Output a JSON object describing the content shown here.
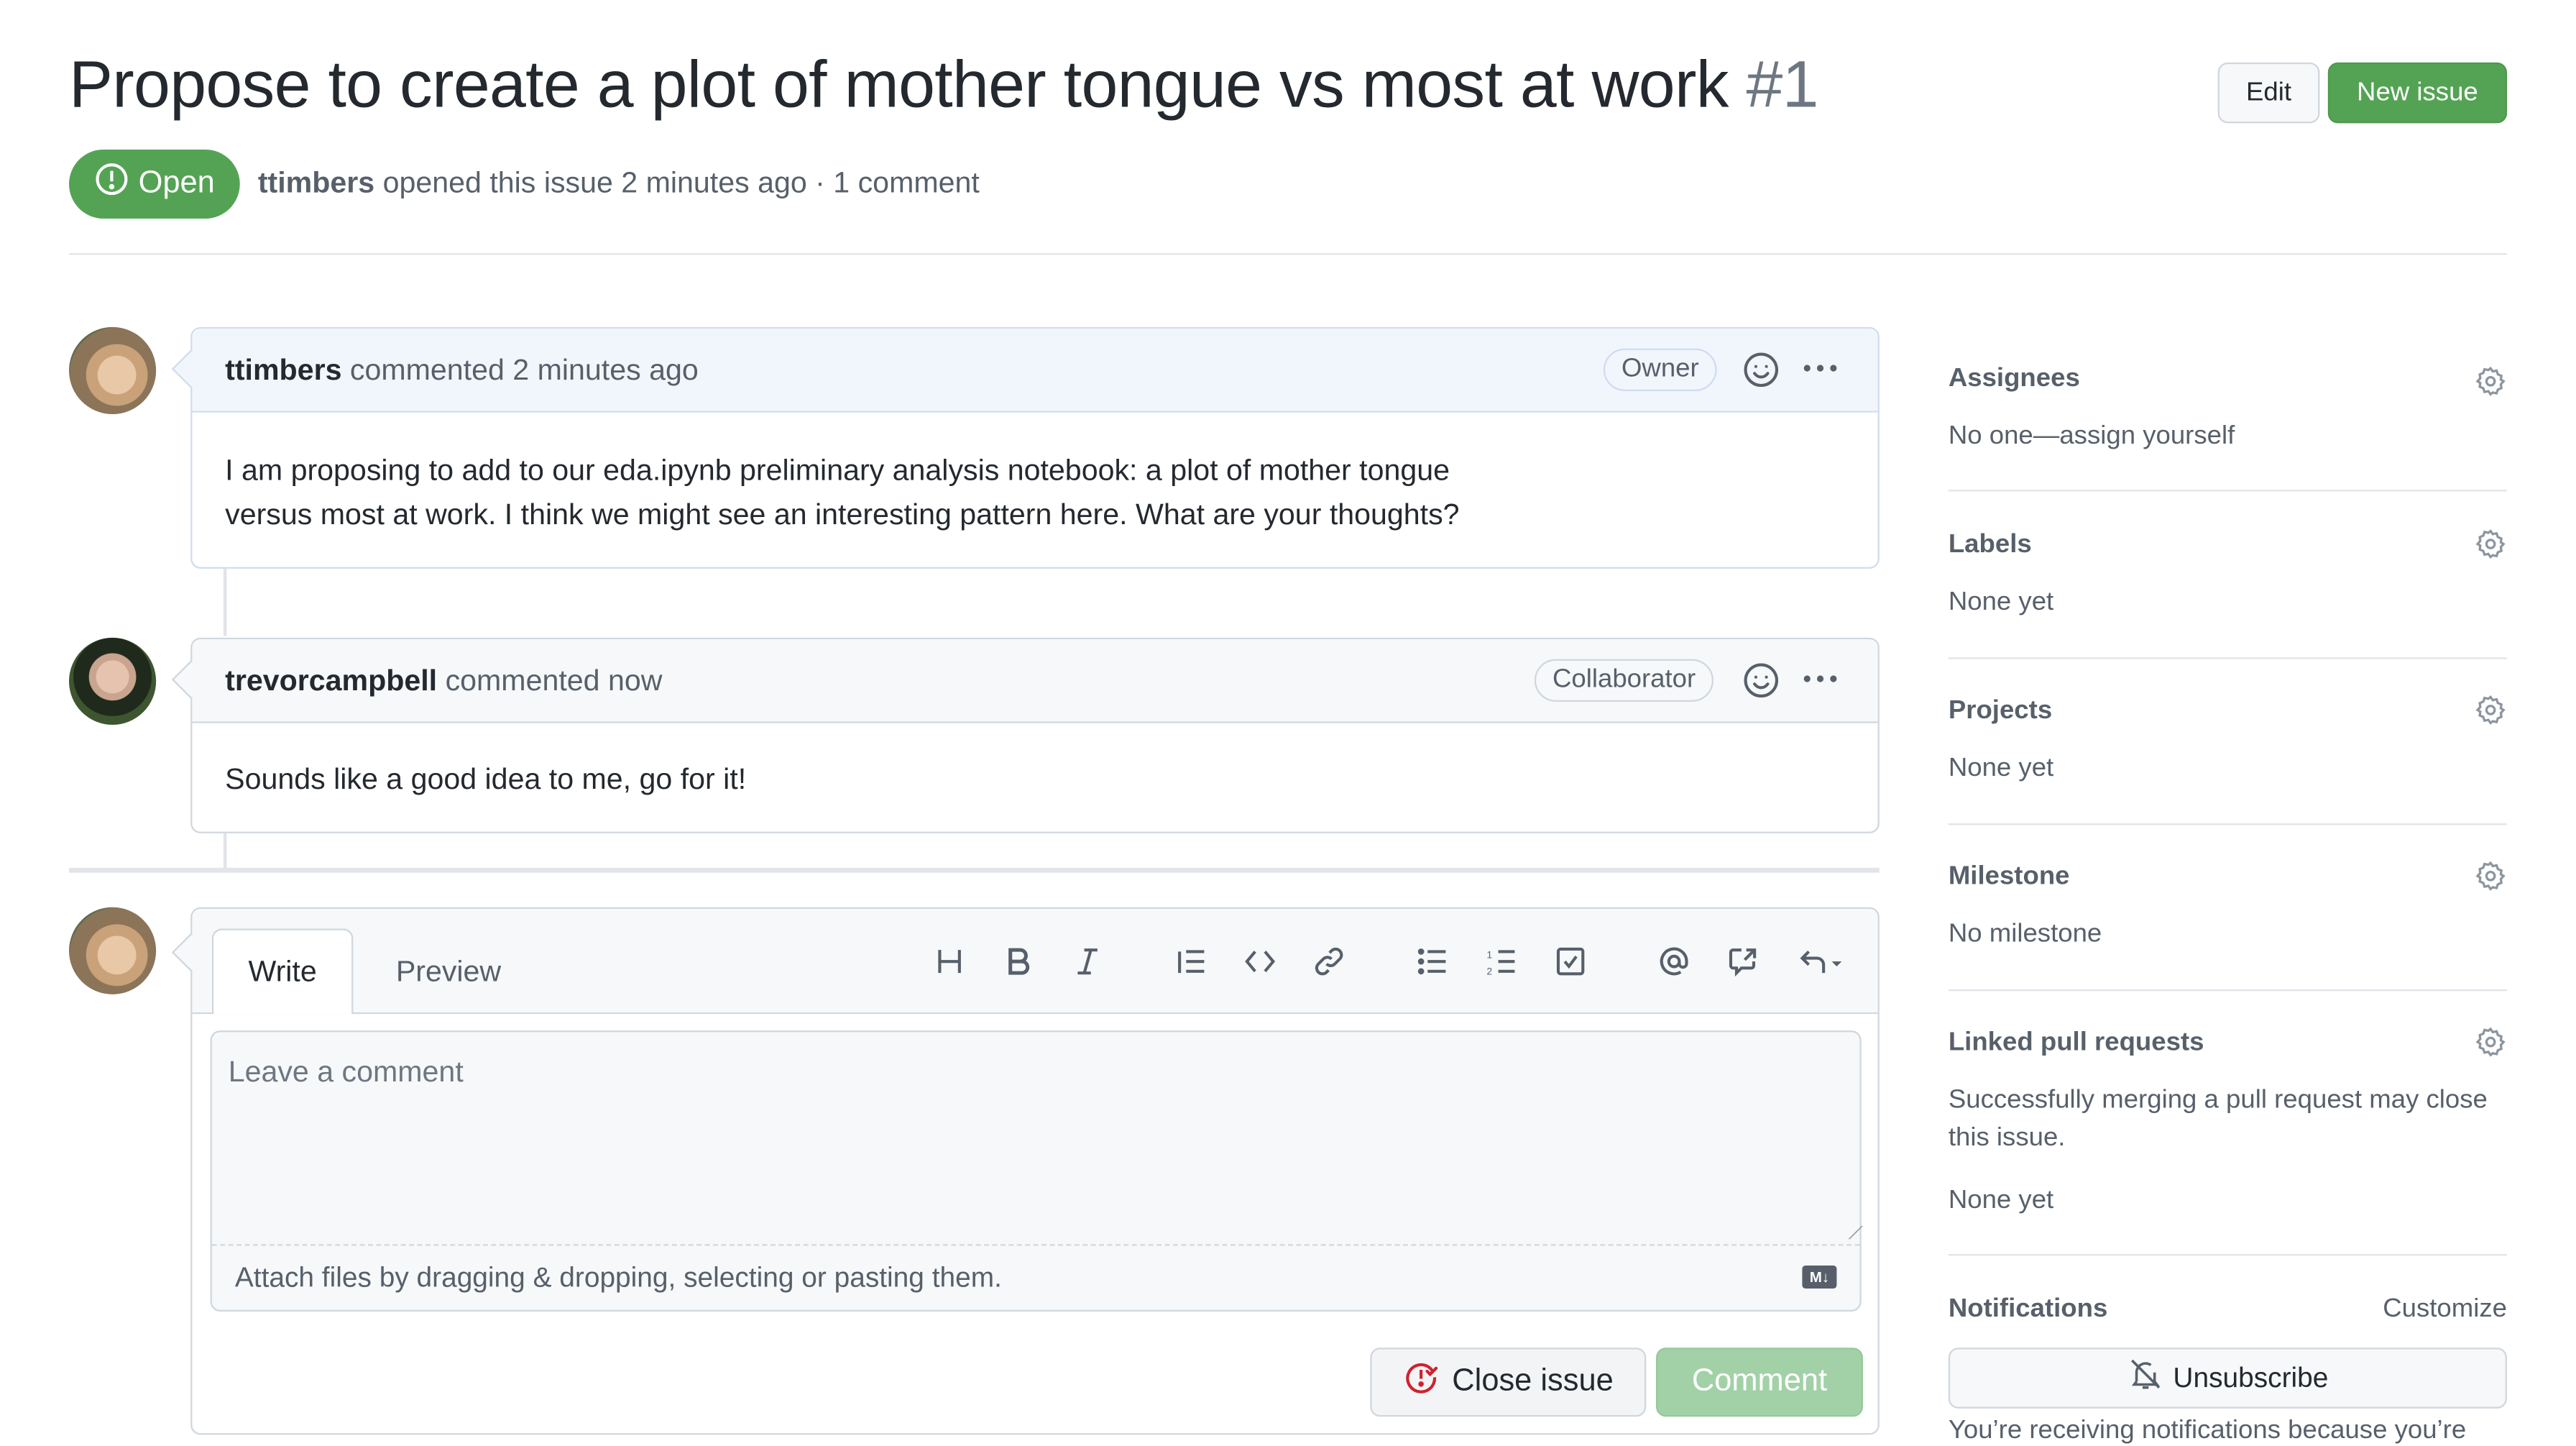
{
  "issue": {
    "title": "Propose to create a plot of mother tongue vs most at work",
    "number": "#1",
    "state": "Open",
    "author": "ttimbers",
    "meta_text": "opened this issue 2 minutes ago · 1 comment"
  },
  "header_actions": {
    "edit_label": "Edit",
    "new_issue_label": "New issue"
  },
  "comments": [
    {
      "author": "ttimbers",
      "action": "commented 2 minutes ago",
      "role": "Owner",
      "body_line1": "I am proposing to add to our eda.ipynb preliminary analysis notebook: a plot of mother tongue",
      "body_line2": "versus most at work. I think we might see an interesting pattern here. What are your thoughts?"
    },
    {
      "author": "trevorcampbell",
      "action": "commented now",
      "role": "Collaborator",
      "body": "Sounds like a good idea to me, go for it!"
    }
  ],
  "editor": {
    "tabs": [
      "Write",
      "Preview"
    ],
    "placeholder": "Leave a comment",
    "value": "",
    "attach_hint": "Attach files by dragging & dropping, selecting or pasting them.",
    "markdown_badge": "M↓",
    "toolbar": [
      "heading",
      "bold",
      "italic",
      "quote",
      "code",
      "link",
      "unordered-list",
      "ordered-list",
      "task-list",
      "mention",
      "cross-reference",
      "saved-replies"
    ],
    "close_issue_label": "Close issue",
    "comment_label": "Comment"
  },
  "sidebar": {
    "sections": [
      {
        "title": "Assignees",
        "value": "No one—assign yourself"
      },
      {
        "title": "Labels",
        "value": "None yet"
      },
      {
        "title": "Projects",
        "value": "None yet"
      },
      {
        "title": "Milestone",
        "value": "No milestone"
      },
      {
        "title": "Linked pull requests",
        "description": "Successfully merging a pull request may close this issue.",
        "value": "None yet"
      }
    ],
    "notifications": {
      "title": "Notifications",
      "customize_label": "Customize",
      "unsubscribe_label": "Unsubscribe",
      "reason": "You’re receiving notifications because you’re"
    }
  },
  "colors": {
    "open_green": "#54a354",
    "primary_button": "#54a354",
    "comment_disabled": "#a2d1a8",
    "close_icon_red": "#cf222e"
  }
}
